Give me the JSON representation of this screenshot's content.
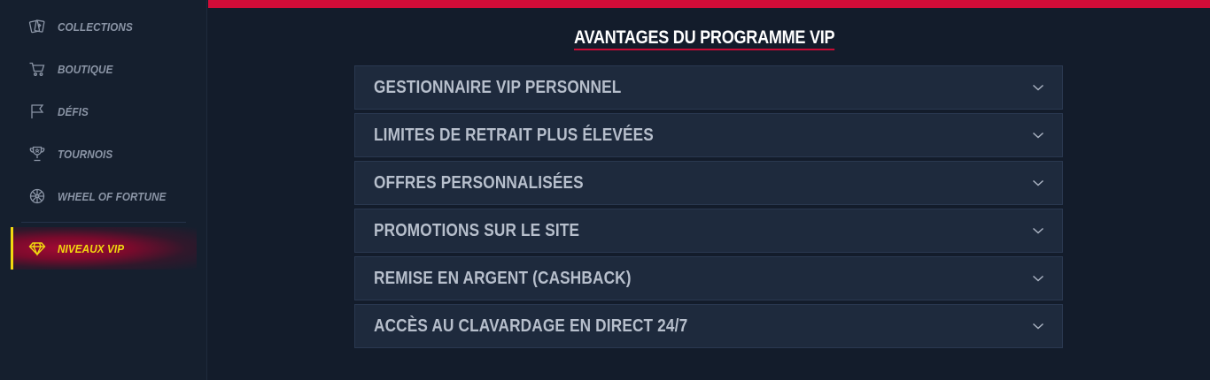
{
  "sidebar": {
    "items": [
      {
        "label": "COLLECTIONS",
        "icon": "cards-icon"
      },
      {
        "label": "BOUTIQUE",
        "icon": "cart-icon"
      },
      {
        "label": "DÉFIS",
        "icon": "flag-icon"
      },
      {
        "label": "TOURNOIS",
        "icon": "trophy-icon"
      },
      {
        "label": "WHEEL OF FORTUNE",
        "icon": "wheel-icon"
      },
      {
        "label": "NIVEAUX VIP",
        "icon": "diamond-icon",
        "active": true
      }
    ],
    "active_color": "#f1d90f",
    "active_bg": "#a20a34"
  },
  "header": {
    "accent_color": "#d10c38"
  },
  "main": {
    "title": "AVANTAGES DU PROGRAMME VIP",
    "accordion": [
      {
        "label": "GESTIONNAIRE VIP PERSONNEL"
      },
      {
        "label": "LIMITES DE RETRAIT PLUS ÉLEVÉES"
      },
      {
        "label": "OFFRES PERSONNALISÉES"
      },
      {
        "label": "PROMOTIONS SUR LE SITE"
      },
      {
        "label": "REMISE EN ARGENT (CASHBACK)"
      },
      {
        "label": "ACCÈS AU CLAVARDAGE EN DIRECT 24/7"
      }
    ]
  }
}
